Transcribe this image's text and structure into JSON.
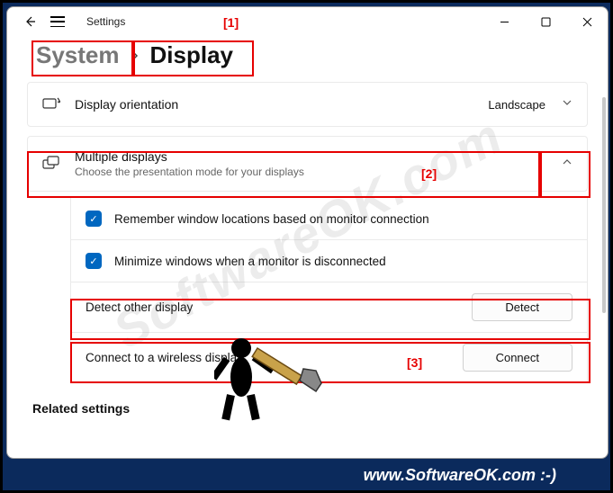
{
  "window": {
    "app_title": "Settings"
  },
  "breadcrumb": {
    "parent": "System",
    "current": "Display"
  },
  "orientation": {
    "label": "Display orientation",
    "value": "Landscape"
  },
  "multiple": {
    "title": "Multiple displays",
    "subtitle": "Choose the presentation mode for your displays",
    "remember": "Remember window locations based on monitor connection",
    "minimize": "Minimize windows when a monitor is disconnected",
    "detect_label": "Detect other display",
    "detect_btn": "Detect",
    "connect_label": "Connect to a wireless display",
    "connect_btn": "Connect"
  },
  "related": {
    "heading": "Related settings"
  },
  "markers": {
    "m1": "[1]",
    "m2": "[2]",
    "m3": "[3]"
  },
  "footer": "www.SoftwareOK.com :-)",
  "watermark": "SoftwareOK.com"
}
